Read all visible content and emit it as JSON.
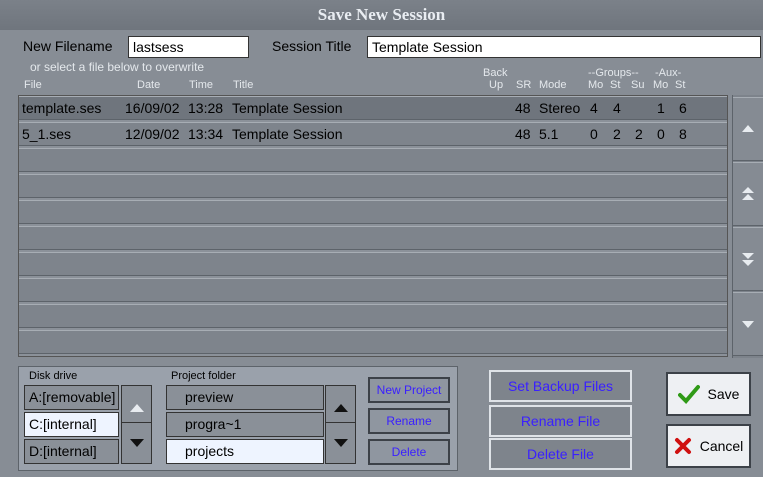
{
  "window": {
    "title": "Save New Session"
  },
  "form": {
    "filename_label": "New Filename",
    "filename_value": "lastsess",
    "session_title_label": "Session Title",
    "session_title_value": "Template Session",
    "hint": "or select a file below to overwrite"
  },
  "columns": {
    "file": "File",
    "date": "Date",
    "time": "Time",
    "title": "Title",
    "back": "Back",
    "up": "Up",
    "sr": "SR",
    "mode": "Mode",
    "groups": "--Groups--",
    "aux": "-Aux-",
    "mo": "Mo",
    "st": "St",
    "su": "Su",
    "mo2": "Mo",
    "st2": "St"
  },
  "files": [
    {
      "file": "template.ses",
      "date": "16/09/02",
      "time": "13:28",
      "title": "Template Session",
      "sr": "48",
      "mode": "Stereo",
      "mo": "4",
      "st": "4",
      "su": "",
      "mo2": "1",
      "st2": "6"
    },
    {
      "file": "5_1.ses",
      "date": "12/09/02",
      "time": "13:34",
      "title": "Template Session",
      "sr": "48",
      "mode": "5.1",
      "mo": "0",
      "st": "2",
      "su": "2",
      "mo2": "0",
      "st2": "8"
    }
  ],
  "disk": {
    "label": "Disk drive",
    "items": [
      "A:[removable]",
      "C:[internal]",
      "D:[internal]"
    ],
    "selected": 1
  },
  "project": {
    "label": "Project folder",
    "items": [
      "preview",
      "progra~1",
      "projects"
    ],
    "selected": 2,
    "new_label": "New Project",
    "rename_label": "Rename",
    "delete_label": "Delete"
  },
  "actions": {
    "set_backup": "Set Backup Files",
    "rename_file": "Rename File",
    "delete_file": "Delete File",
    "save": "Save",
    "cancel": "Cancel"
  },
  "colors": {
    "link_text": "#3a20ff",
    "save_check": "#2f9a16",
    "cancel_x": "#d01010"
  }
}
